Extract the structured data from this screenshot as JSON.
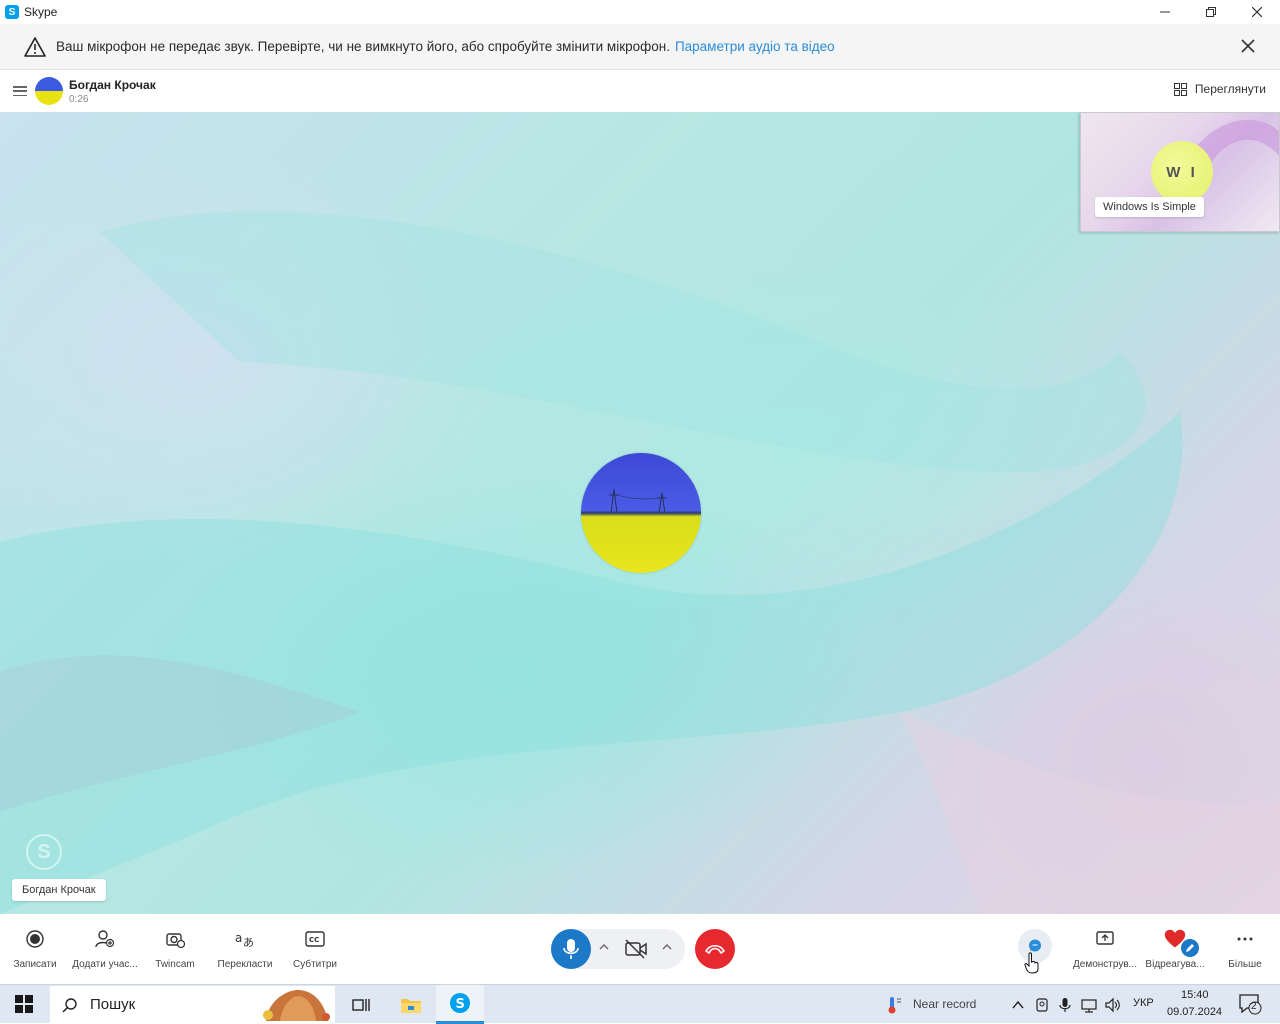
{
  "window": {
    "title": "Skype",
    "controls": [
      "minimize-icon",
      "restore-icon",
      "close-icon"
    ]
  },
  "warning": {
    "message": "Ваш мікрофон не передає звук. Перевірте, чи не вимкнуто його, або спробуйте змінити мікрофон.",
    "link": "Параметри аудіо та відео"
  },
  "call_header": {
    "contact_name": "Богдан Крочак",
    "duration": "0:26",
    "view_label": "Переглянути"
  },
  "stage": {
    "self_view_initials": "W I",
    "self_view_name": "Windows Is Simple",
    "participant_name_tag": "Богдан Крочак"
  },
  "controls": {
    "record": "Записати",
    "add_participants": "Додати учас...",
    "twincam": "Twincam",
    "translate": "Перекласти",
    "subtitles": "Субтитри",
    "share_screen": "Демонструв...",
    "react": "Відреагува...",
    "more": "Більше"
  },
  "taskbar": {
    "search_placeholder": "Пошук",
    "weather": "Near record",
    "language": "УКР",
    "time": "15:40",
    "date": "09.07.2024",
    "notification_count": "2"
  },
  "colors": {
    "accent": "#2b8cd8",
    "mic_active": "#1c79c7",
    "end_call": "#e5292e",
    "react_heart": "#e02a2a"
  }
}
